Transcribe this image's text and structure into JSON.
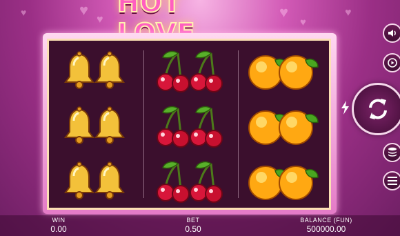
{
  "game": {
    "title": "HOT LOVE"
  },
  "reels": [
    {
      "symbols": [
        "bells",
        "bells",
        "bells"
      ]
    },
    {
      "symbols": [
        "cherries",
        "cherries",
        "cherries"
      ]
    },
    {
      "symbols": [
        "oranges",
        "oranges",
        "oranges"
      ]
    }
  ],
  "footer": {
    "win_label": "WIN",
    "win_value": "0.00",
    "bet_label": "BET",
    "bet_value": "0.50",
    "balance_label": "BALANCE (FUN)",
    "balance_value": "500000.00"
  },
  "controls": {
    "sound_icon": "speaker-icon",
    "autoplay_icon": "autoplay-icon",
    "spin_icon": "spin-arrows-icon",
    "turbo_icon": "lightning-icon",
    "bet_icon": "coin-stack-icon",
    "menu_icon": "menu-icon"
  },
  "colors": {
    "accent": "#ff5fc0",
    "board": "#3b0f2d",
    "frame": "#fbe0b4"
  }
}
